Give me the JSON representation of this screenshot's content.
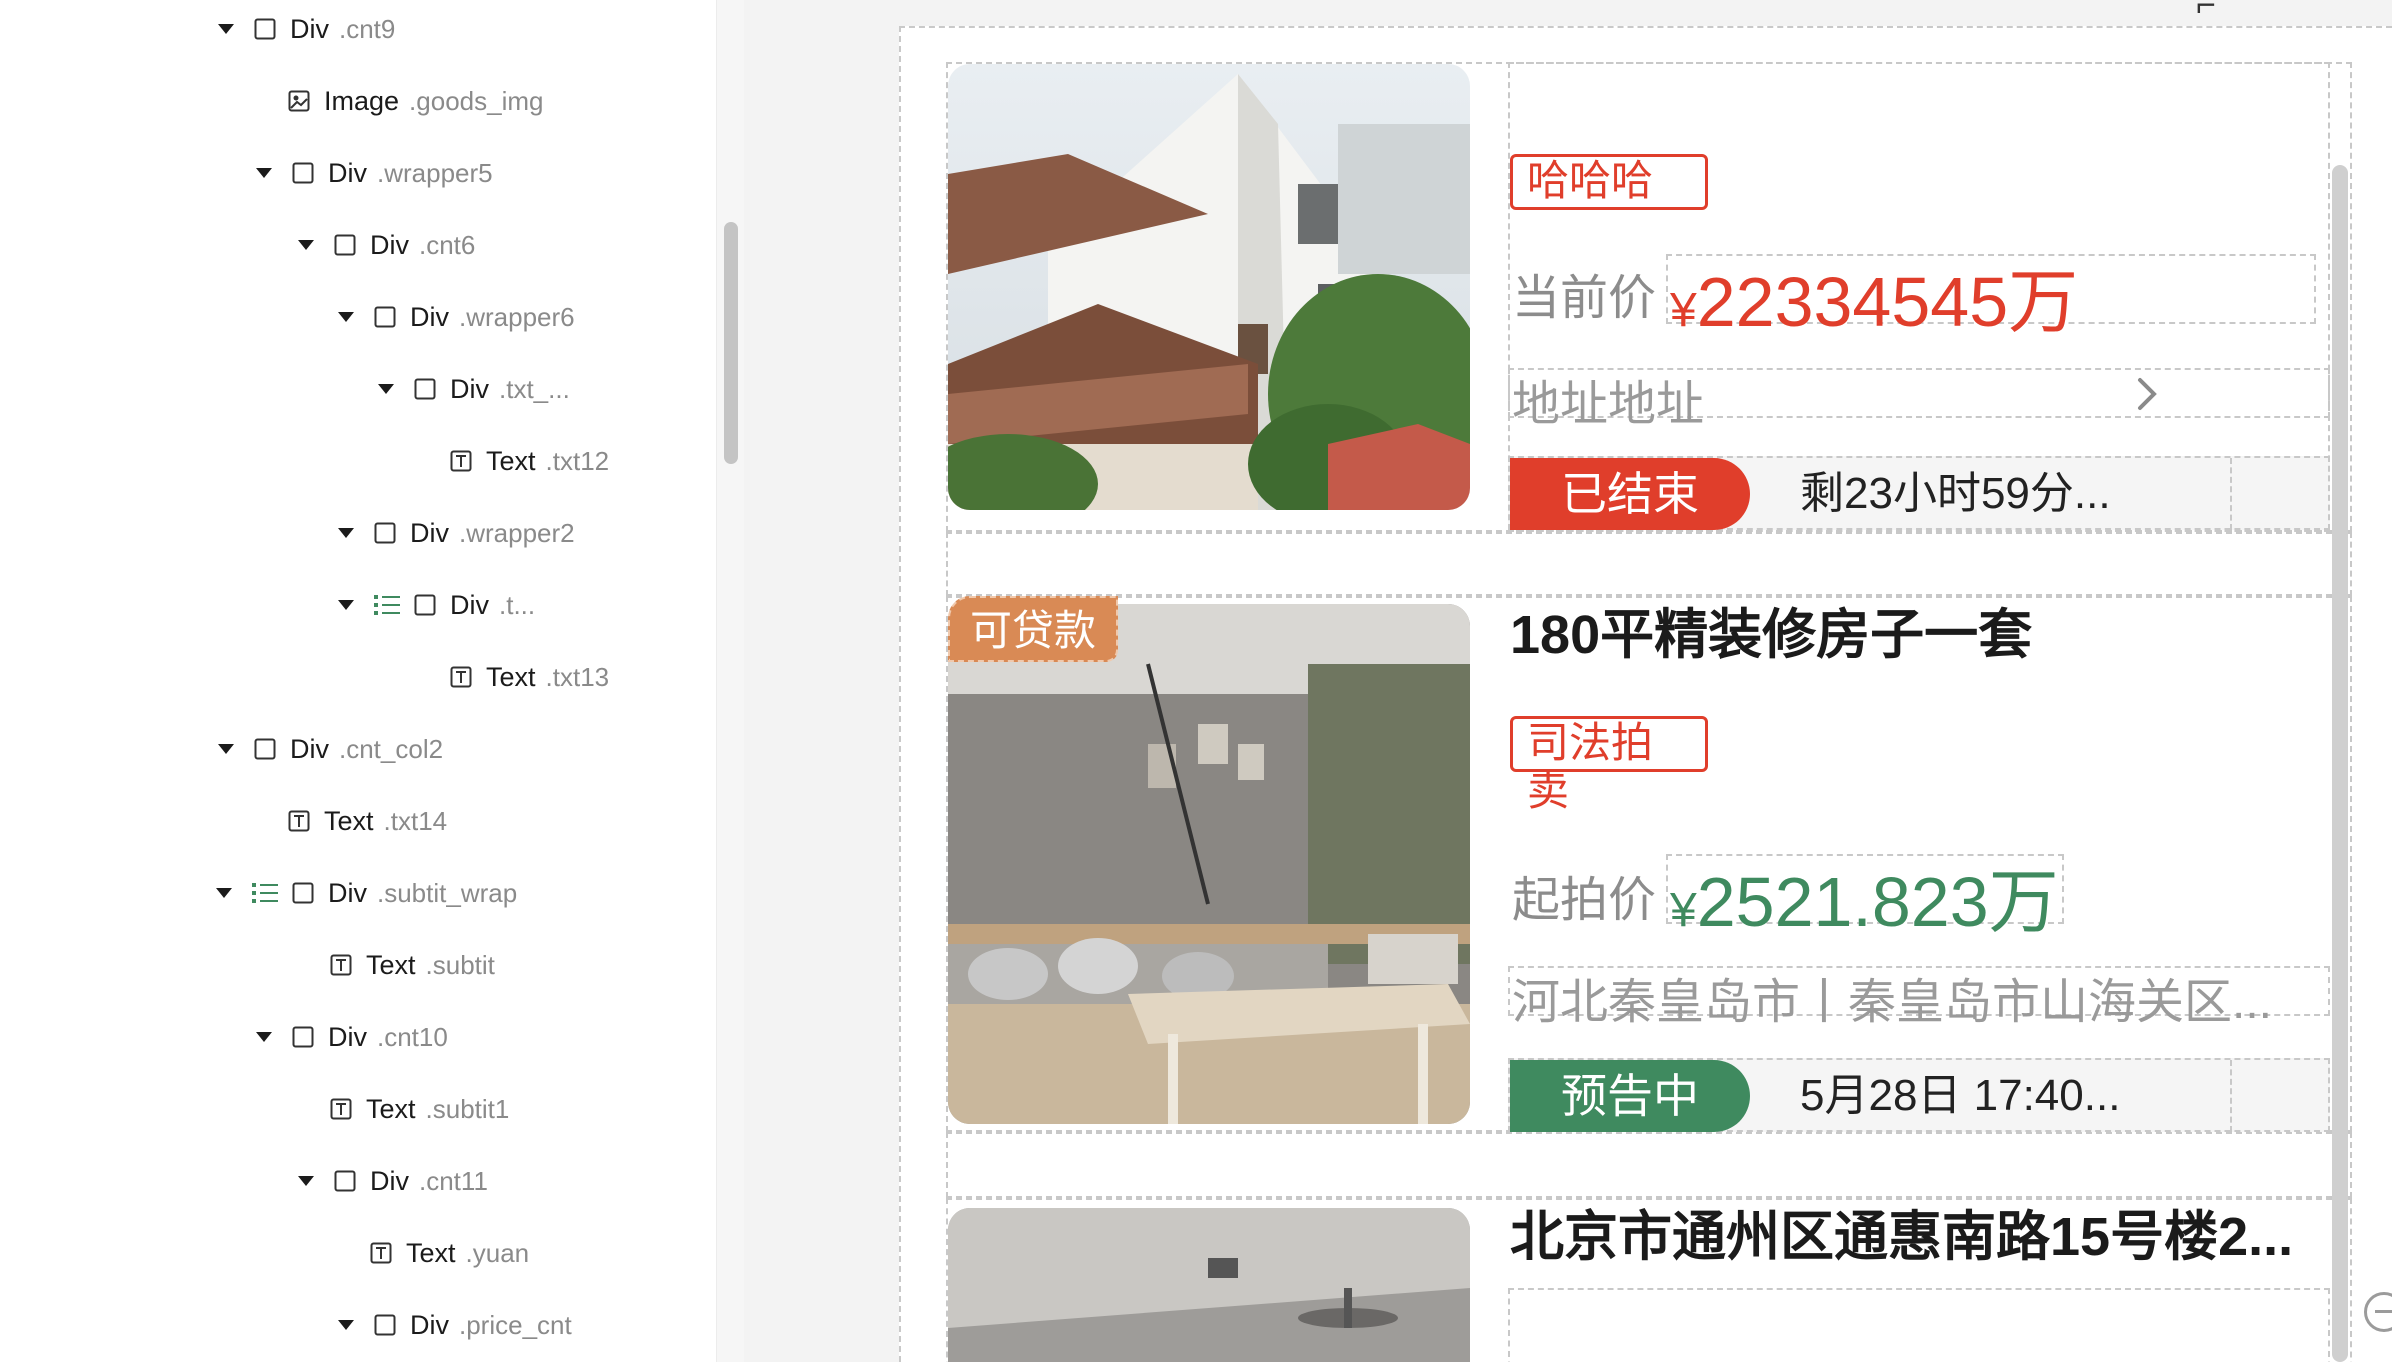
{
  "tree": {
    "rows": [
      {
        "type": "Div",
        "cls": ".cnt9",
        "caret": true,
        "list": false,
        "icon": "div"
      },
      {
        "type": "Image",
        "cls": ".goods_img",
        "caret": false,
        "list": false,
        "icon": "image"
      },
      {
        "type": "Div",
        "cls": ".wrapper5",
        "caret": true,
        "list": false,
        "icon": "div"
      },
      {
        "type": "Div",
        "cls": ".cnt6",
        "caret": true,
        "list": false,
        "icon": "div"
      },
      {
        "type": "Div",
        "cls": ".wrapper6",
        "caret": true,
        "list": false,
        "icon": "div"
      },
      {
        "type": "Div",
        "cls": ".txt_...",
        "caret": true,
        "list": false,
        "icon": "div"
      },
      {
        "type": "Text",
        "cls": ".txt12",
        "caret": false,
        "list": false,
        "icon": "text"
      },
      {
        "type": "Div",
        "cls": ".wrapper2",
        "caret": true,
        "list": false,
        "icon": "div"
      },
      {
        "type": "Div",
        "cls": ".t...",
        "caret": true,
        "list": true,
        "icon": "div"
      },
      {
        "type": "Text",
        "cls": ".txt13",
        "caret": false,
        "list": false,
        "icon": "text"
      },
      {
        "type": "Div",
        "cls": ".cnt_col2",
        "caret": true,
        "list": false,
        "icon": "div"
      },
      {
        "type": "Text",
        "cls": ".txt14",
        "caret": false,
        "list": false,
        "icon": "text"
      },
      {
        "type": "Div",
        "cls": ".subtit_wrap",
        "caret": true,
        "list": true,
        "icon": "div"
      },
      {
        "type": "Text",
        "cls": ".subtit",
        "caret": false,
        "list": false,
        "icon": "text"
      },
      {
        "type": "Div",
        "cls": ".cnt10",
        "caret": true,
        "list": false,
        "icon": "div"
      },
      {
        "type": "Text",
        "cls": ".subtit1",
        "caret": false,
        "list": false,
        "icon": "text"
      },
      {
        "type": "Div",
        "cls": ".cnt11",
        "caret": true,
        "list": false,
        "icon": "div"
      },
      {
        "type": "Text",
        "cls": ".yuan",
        "caret": false,
        "list": false,
        "icon": "text"
      },
      {
        "type": "Div",
        "cls": ".price_cnt",
        "caret": true,
        "list": false,
        "icon": "div"
      }
    ]
  },
  "colors": {
    "red": "#e03e2b",
    "green": "#3f8a5f",
    "orange": "#d98a55"
  },
  "cards": [
    {
      "tag": "哈哈哈",
      "price_label": "当前价",
      "yen": "¥",
      "price": "22334545万",
      "address": "地址地址",
      "status": "已结束",
      "time": "剩23小时59分..."
    },
    {
      "badge": "可贷款",
      "title": "180平精装修房子一套",
      "tag": "司法拍卖",
      "price_label": "起拍价",
      "yen": "¥",
      "price": "2521.823万",
      "address": "河北秦皇岛市丨秦皇岛市山海关区...",
      "status": "预告中",
      "time": "5月28日 17:40..."
    },
    {
      "title": "北京市通州区通惠南路15号楼2..."
    }
  ]
}
